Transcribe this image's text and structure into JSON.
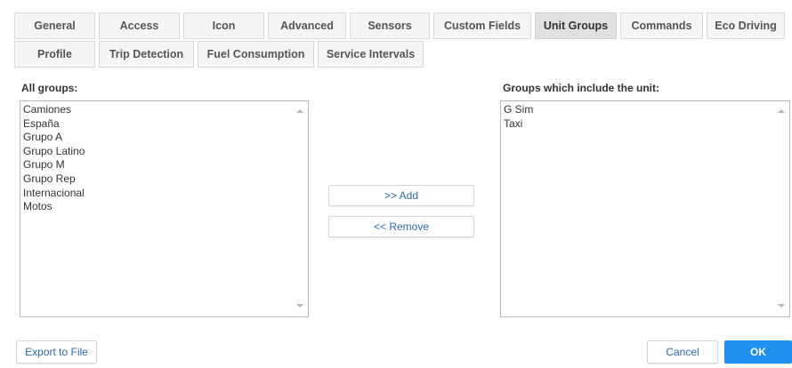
{
  "tabs": {
    "row1": [
      "General",
      "Access",
      "Icon",
      "Advanced",
      "Sensors",
      "Custom Fields",
      "Unit Groups",
      "Commands",
      "Eco Driving"
    ],
    "row2": [
      "Profile",
      "Trip Detection",
      "Fuel Consumption",
      "Service Intervals"
    ],
    "active": "Unit Groups"
  },
  "left": {
    "label": "All groups:",
    "items": [
      "Camiones",
      "España",
      "Grupo A",
      "Grupo Latino",
      "Grupo M",
      "Grupo Rep",
      "Internacional",
      "Motos"
    ]
  },
  "right": {
    "label": "Groups which include the unit:",
    "items": [
      "G Sim",
      "Taxi"
    ]
  },
  "actions": {
    "add": ">> Add",
    "remove": "<< Remove"
  },
  "footer": {
    "export": "Export to File",
    "cancel": "Cancel",
    "ok": "OK"
  },
  "colors": {
    "primary": "#1e90f0",
    "link": "#2a6ab0",
    "active_tab": "#e0e0e0"
  }
}
